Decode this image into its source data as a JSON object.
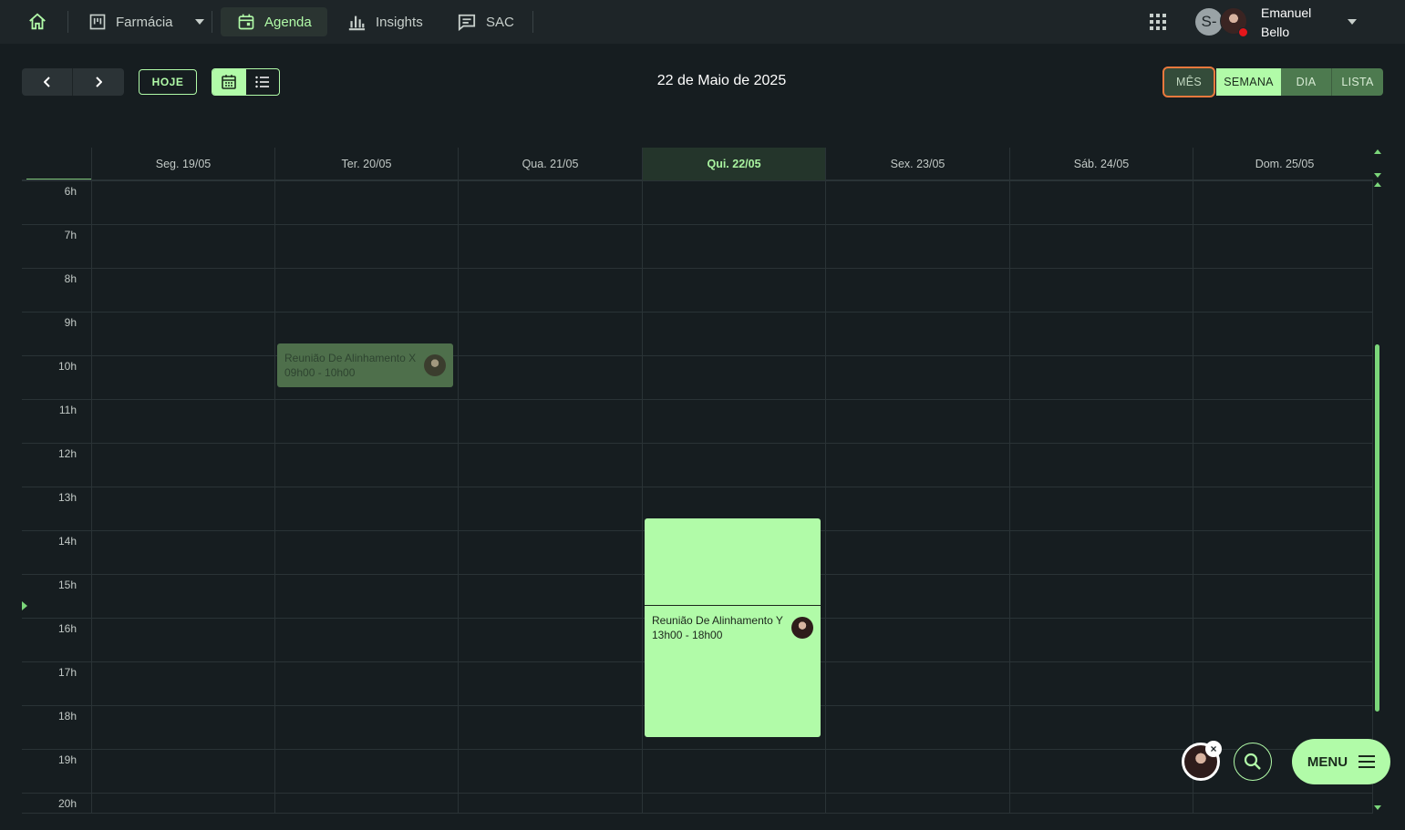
{
  "nav": {
    "pharmacy": "Farmácia",
    "agenda": "Agenda",
    "insights": "Insights",
    "sac": "SAC",
    "user_initial": "S-",
    "user_name": "Emanuel Bello"
  },
  "toolbar": {
    "today": "HOJE",
    "current_date": "22 de Maio de 2025",
    "views": {
      "month": "MÊS",
      "week": "SEMANA",
      "day": "DIA",
      "list": "LISTA"
    }
  },
  "calendar": {
    "days": [
      "Seg. 19/05",
      "Ter. 20/05",
      "Qua. 21/05",
      "Qui. 22/05",
      "Sex. 23/05",
      "Sáb. 24/05",
      "Dom. 25/05"
    ],
    "hours": [
      "6h",
      "7h",
      "8h",
      "9h",
      "10h",
      "11h",
      "12h",
      "13h",
      "14h",
      "15h",
      "16h",
      "17h",
      "18h",
      "19h",
      "20h"
    ],
    "events": [
      {
        "title": "Reunião De Alinhamento X",
        "time": "09h00 - 10h00"
      },
      {
        "title": "Reunião De Alinhamento Y",
        "time": "13h00 - 18h00"
      }
    ]
  },
  "fab": {
    "menu": "MENU",
    "close": "×"
  },
  "colors": {
    "accent": "#b1fba8",
    "background": "#161d20",
    "topbar": "#1e2528",
    "focus_ring": "#e8783d"
  }
}
